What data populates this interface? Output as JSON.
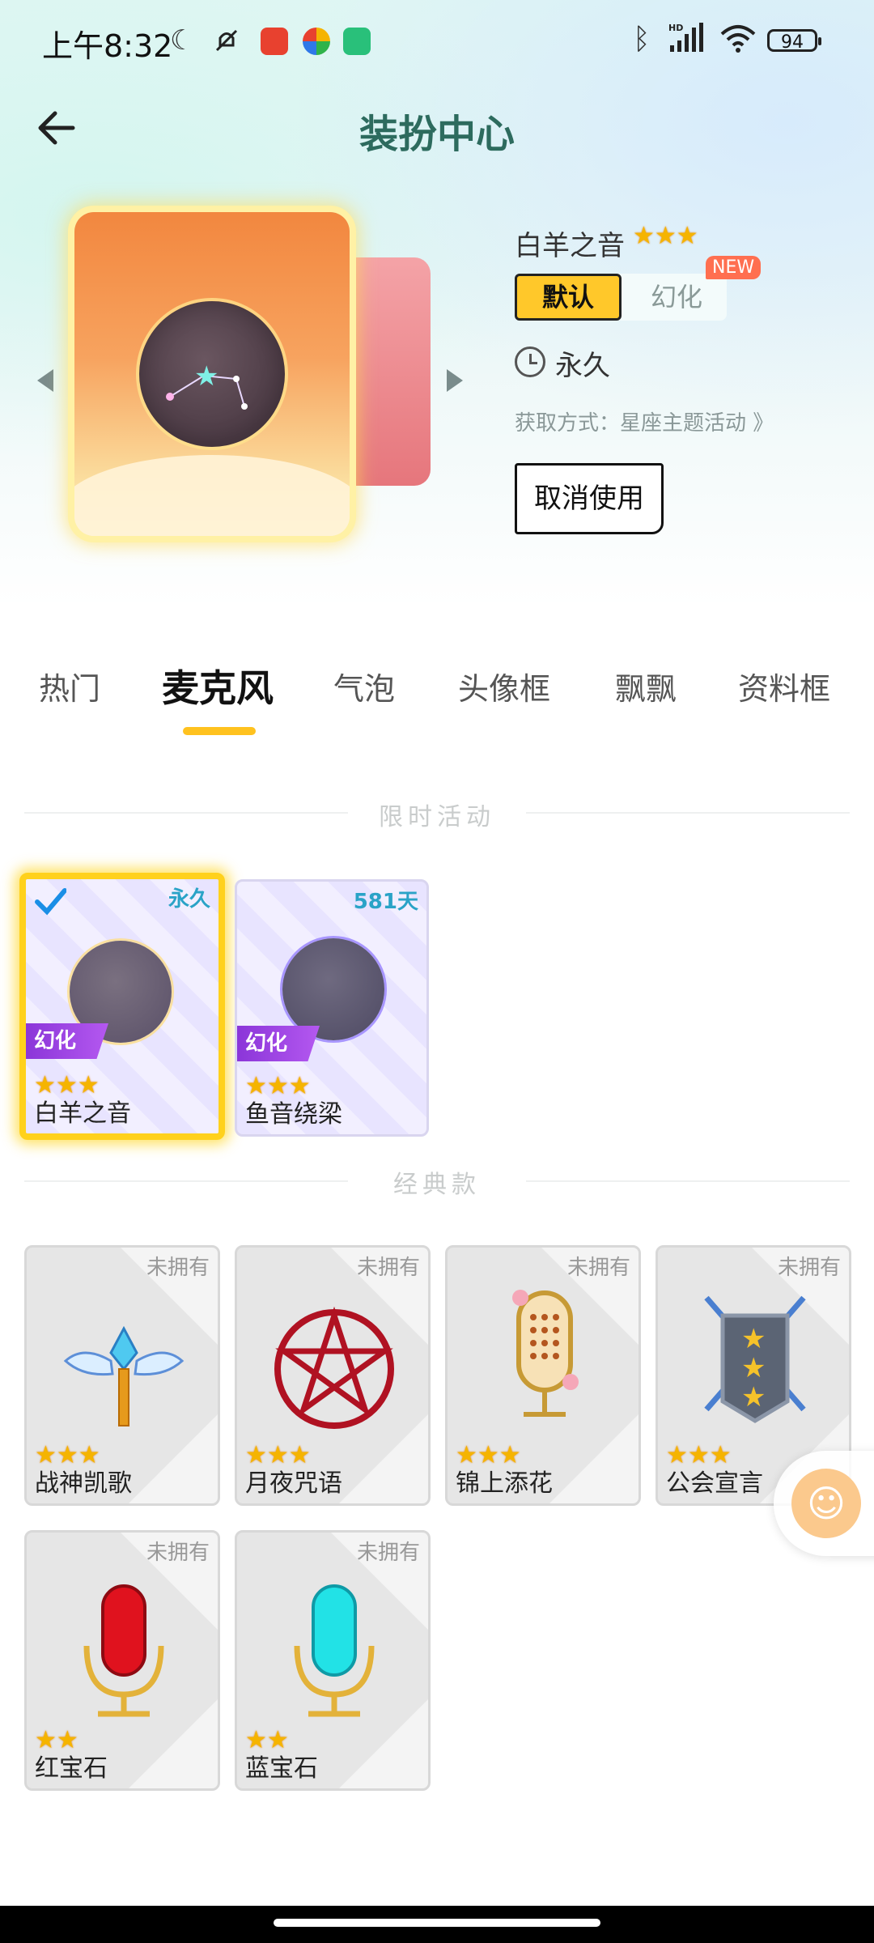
{
  "status_bar": {
    "time": "上午8:32",
    "battery": "94",
    "icons": [
      "moon-icon",
      "mute-icon",
      "app-icon-game",
      "app-icon-pinwheel",
      "app-icon-shield",
      "bluetooth-icon",
      "signal-hd-icon",
      "wifi-icon",
      "battery-icon"
    ]
  },
  "header": {
    "title": "装扮中心",
    "back_icon": "arrow-left-icon"
  },
  "preview": {
    "item_name": "白羊之音",
    "stars": "★★★",
    "style_default": "默认",
    "style_illusion": "幻化",
    "new_badge": "NEW",
    "duration": "永久",
    "acquire_text": "获取方式：星座主题活动 》",
    "cancel_button": "取消使用"
  },
  "tabs": [
    {
      "label": "热门"
    },
    {
      "label": "麦克风",
      "active": true
    },
    {
      "label": "气泡"
    },
    {
      "label": "头像框"
    },
    {
      "label": "飘飘"
    },
    {
      "label": "资料框"
    }
  ],
  "sections": {
    "limited": {
      "title": "限时活动",
      "items": [
        {
          "name": "白羊之音",
          "tag": "永久",
          "badge": "幻化",
          "stars": "★★★",
          "selected": true
        },
        {
          "name": "鱼音绕梁",
          "tag": "581天",
          "badge": "幻化",
          "stars": "★★★"
        }
      ]
    },
    "classic": {
      "title": "经典款",
      "items": [
        {
          "name": "战神凯歌",
          "tag": "未拥有",
          "stars": "★★★"
        },
        {
          "name": "月夜咒语",
          "tag": "未拥有",
          "stars": "★★★"
        },
        {
          "name": "锦上添花",
          "tag": "未拥有",
          "stars": "★★★"
        },
        {
          "name": "公会宣言",
          "tag": "未拥有",
          "stars": "★★★"
        },
        {
          "name": "红宝石",
          "tag": "未拥有",
          "stars": "★★"
        },
        {
          "name": "蓝宝石",
          "tag": "未拥有",
          "stars": "★★"
        }
      ]
    }
  },
  "colors": {
    "accent": "#ffc82a",
    "title": "#2d6b5e",
    "illusion": "#8a35d8"
  }
}
